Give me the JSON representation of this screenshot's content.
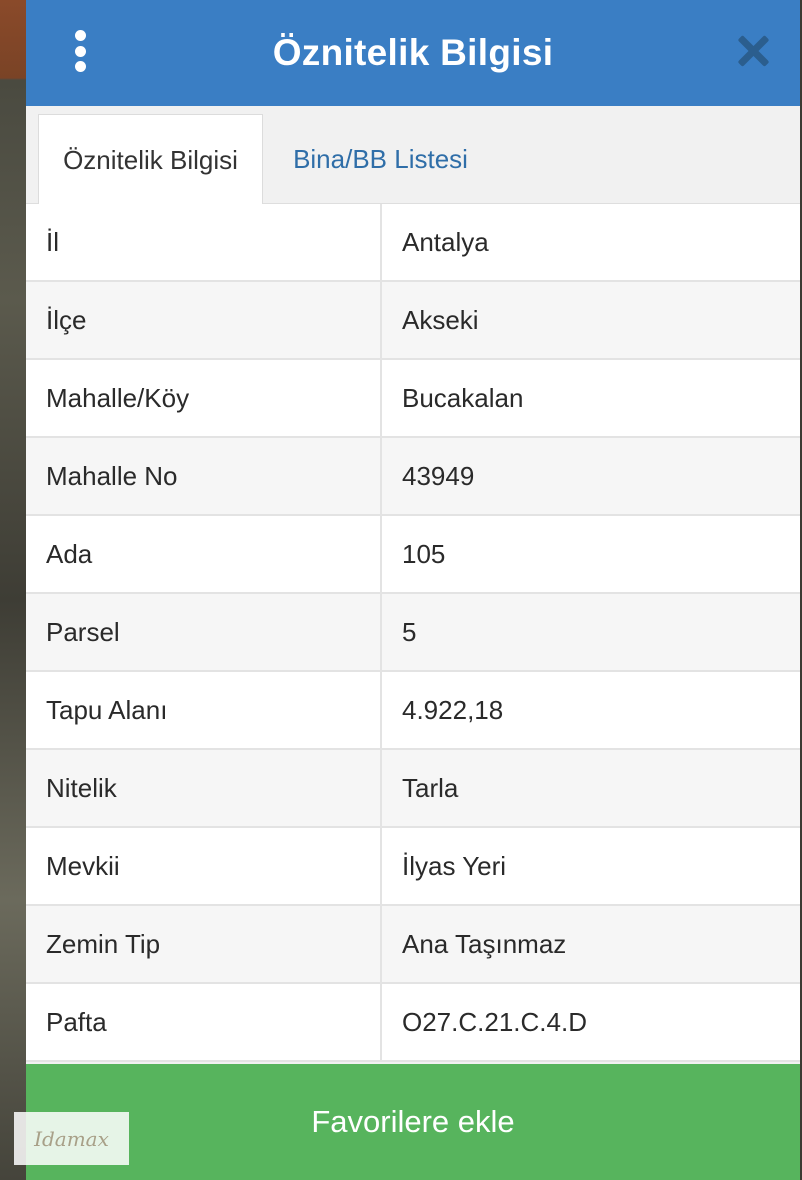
{
  "header": {
    "title": "Öznitelik Bilgisi",
    "menu_icon": "more-vertical-icon",
    "close_icon": "close-icon",
    "color": "#3a7ec4"
  },
  "tabs": [
    {
      "label": "Öznitelik Bilgisi",
      "active": true
    },
    {
      "label": "Bina/BB Listesi",
      "active": false
    }
  ],
  "attributes": [
    {
      "key": "İl",
      "value": "Antalya"
    },
    {
      "key": "İlçe",
      "value": "Akseki"
    },
    {
      "key": "Mahalle/Köy",
      "value": "Bucakalan"
    },
    {
      "key": "Mahalle No",
      "value": "43949"
    },
    {
      "key": "Ada",
      "value": "105"
    },
    {
      "key": "Parsel",
      "value": "5"
    },
    {
      "key": "Tapu Alanı",
      "value": "4.922,18"
    },
    {
      "key": "Nitelik",
      "value": "Tarla"
    },
    {
      "key": "Mevkii",
      "value": "İlyas Yeri"
    },
    {
      "key": "Zemin Tip",
      "value": "Ana Taşınmaz"
    },
    {
      "key": "Pafta",
      "value": "O27.C.21.C.4.D"
    }
  ],
  "footer": {
    "favorite_label": "Favorilere ekle",
    "color": "#57b45d"
  },
  "logo": {
    "text": "Idamax"
  }
}
